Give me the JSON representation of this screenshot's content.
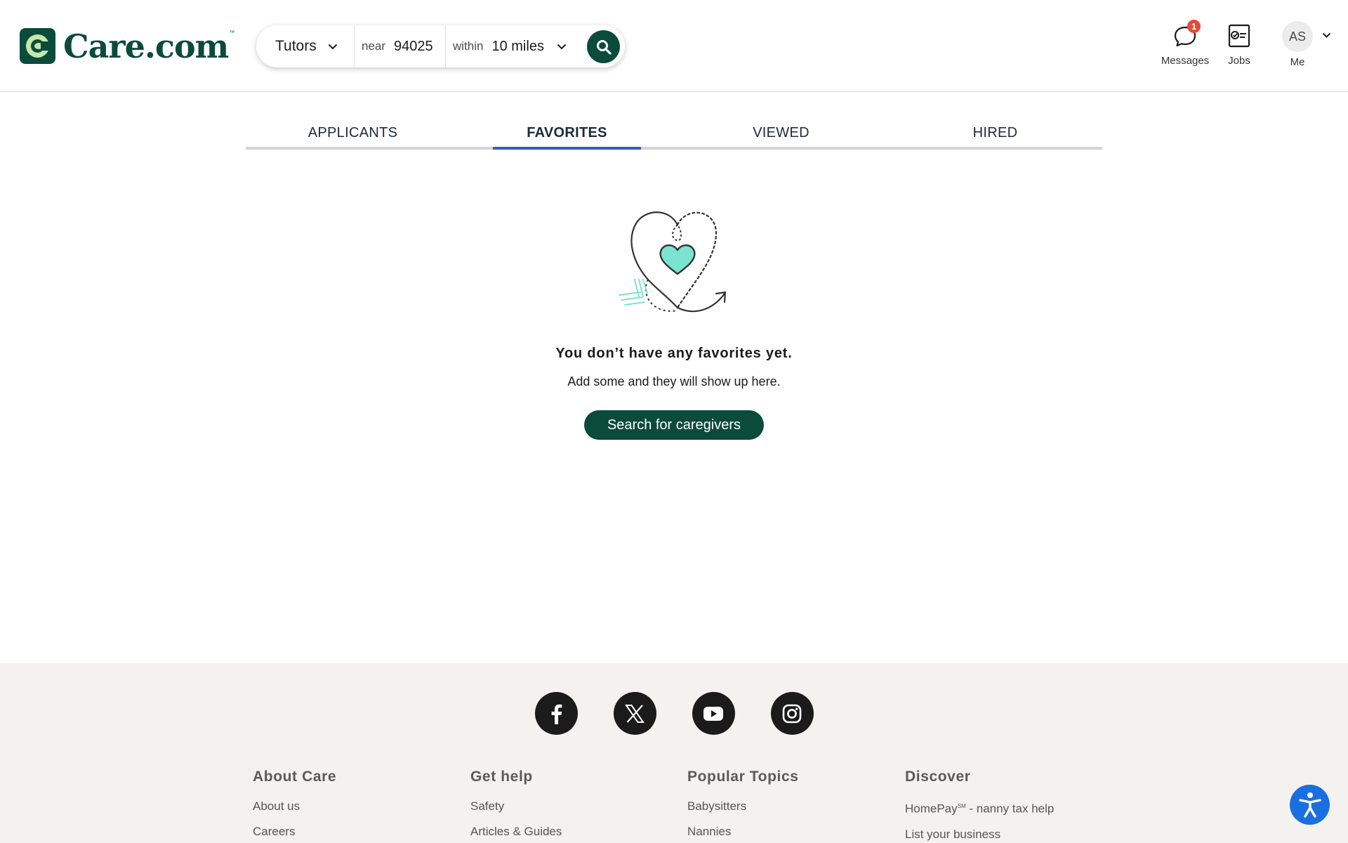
{
  "brand": {
    "name": "Care.com",
    "tm": "™"
  },
  "search": {
    "type_value": "Tutors",
    "near_label": "near",
    "near_value": "94025",
    "within_label": "within",
    "within_value": "10 miles"
  },
  "header_nav": {
    "messages_label": "Messages",
    "messages_badge": "1",
    "jobs_label": "Jobs",
    "me_label": "Me",
    "avatar_initials": "AS"
  },
  "tabs": [
    {
      "label": "APPLICANTS",
      "active": false
    },
    {
      "label": "FAVORITES",
      "active": true
    },
    {
      "label": "VIEWED",
      "active": false
    },
    {
      "label": "HIRED",
      "active": false
    }
  ],
  "empty_state": {
    "title": "You don’t have any favorites yet.",
    "subtitle": "Add some and they will show up here.",
    "cta": "Search for caregivers"
  },
  "footer": {
    "socials": [
      "facebook-icon",
      "x-icon",
      "youtube-icon",
      "instagram-icon"
    ],
    "columns": [
      {
        "heading": "About Care",
        "links": [
          "About us",
          "Careers"
        ]
      },
      {
        "heading": "Get help",
        "links": [
          "Safety",
          "Articles & Guides"
        ]
      },
      {
        "heading": "Popular Topics",
        "links": [
          "Babysitters",
          "Nannies"
        ]
      },
      {
        "heading": "Discover",
        "links": [
          "HomePay",
          "List your business"
        ],
        "homepay_sup": "SM",
        "homepay_suffix": " - nanny tax help"
      }
    ]
  },
  "colors": {
    "brand_green": "#0b4b3b",
    "tab_active": "#2d63b0",
    "badge_red": "#e4493a",
    "accessibility_blue": "#1a6fe0",
    "footer_bg": "#f4f2ee",
    "heart_teal": "#7de3d1"
  }
}
